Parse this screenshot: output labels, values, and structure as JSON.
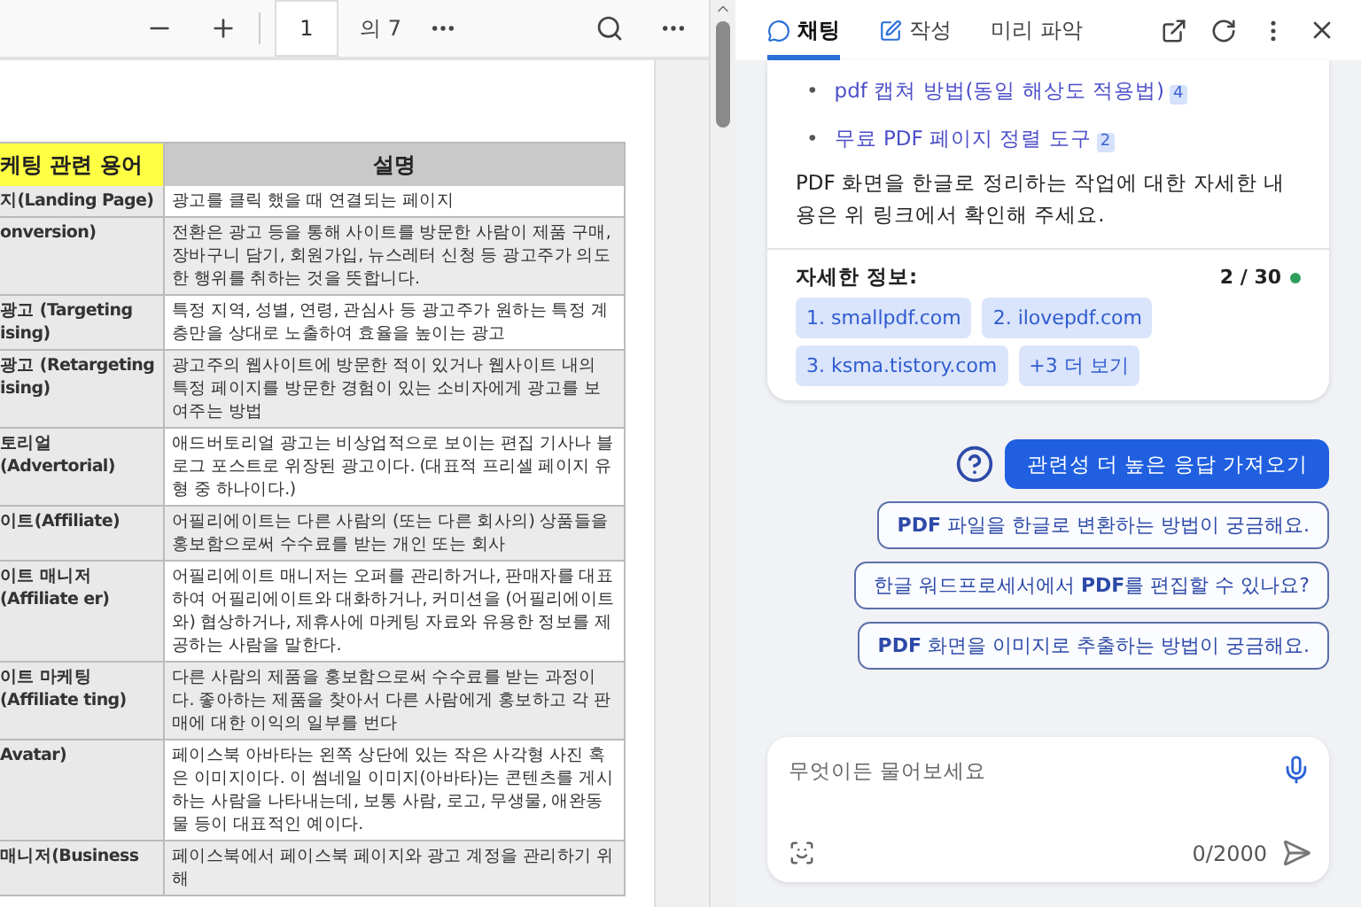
{
  "viewer_toolbar": {
    "page_number": "1",
    "page_total": "의 7"
  },
  "table": {
    "columns": [
      {
        "label": "케팅 관련 용어",
        "kind": "term"
      },
      {
        "label": "설명",
        "kind": "desc"
      }
    ],
    "rows": [
      {
        "term": "지(Landing Page)",
        "description": "광고를 클릭 했을 때 연결되는 페이지"
      },
      {
        "term": "onversion)",
        "description": "전환은 광고 등을 통해 사이트를 방문한 사람이 제품 구매, 장바구니 담기, 회원가입, 뉴스레터 신청 등 광고주가 의도한 행위를 취하는 것을 뜻합니다."
      },
      {
        "term": "광고 (Targeting ising)",
        "description": "특정 지역, 성별, 연령, 관심사 등 광고주가 원하는 특정 계층만을 상대로 노출하여 효율을 높이는 광고"
      },
      {
        "term": "광고 (Retargeting ising)",
        "description": "광고주의 웹사이트에 방문한 적이 있거나 웹사이트 내의 특정 페이지를 방문한 경험이 있는 소비자에게 광고를 보여주는 방법"
      },
      {
        "term": "토리얼(Advertorial)",
        "description": "애드버토리얼 광고는 비상업적으로 보이는 편집 기사나 블로그 포스트로 위장된 광고이다. (대표적 프리셀 페이지 유형 중 하나이다.)"
      },
      {
        "term": "이트(Affiliate)",
        "description": "어필리에이트는 다른 사람의 (또는 다른 회사의) 상품들을 홍보함으로써 수수료를 받는 개인 또는 회사"
      },
      {
        "term": "이트 매니저(Affiliate er)",
        "description": "어필리에이트 매니저는 오퍼를 관리하거나, 판매자를 대표하여 어필리에이트와 대화하거나, 커미션을 (어필리에이트와) 협상하거나, 제휴사에 마케팅 자료와 유용한 정보를 제공하는 사람을 말한다."
      },
      {
        "term": "이트 마케팅(Affiliate ting)",
        "description": "다른 사람의 제품을 홍보함으로써 수수료를 받는 과정이다. 좋아하는 제품을 찾아서 다른 사람에게 홍보하고 각 판매에 대한 이익의 일부를 번다"
      },
      {
        "term": "Avatar)",
        "description": "페이스북 아바타는 왼쪽 상단에 있는 작은 사각형 사진 혹은 이미지이다. 이 썸네일 이미지(아바타)는 콘텐츠를 게시하는 사람을 나타내는데, 보통 사람, 로고, 무생물, 애완동물 등이 대표적인 예이다."
      },
      {
        "term": "매니저(Business",
        "description": "페이스북에서 페이스북 페이지와 광고 계정을 관리하기 위해"
      }
    ]
  },
  "chat_header": {
    "tabs": [
      {
        "label": "채팅",
        "kind": "chat",
        "selected": true
      },
      {
        "label": "작성",
        "kind": "write",
        "selected": false
      },
      {
        "label": "미리 파악",
        "kind": "plain",
        "selected": false
      }
    ]
  },
  "answer_card": {
    "links": [
      {
        "bullet": "•",
        "text": "pdf 캡쳐 방법(동일 해상도 적용법)",
        "ref": "4"
      },
      {
        "bullet": "•",
        "text": "무료 PDF 페이지 정렬 도구",
        "ref": "2"
      }
    ],
    "summary": "PDF 화면을 한글로 정리하는 작업에 대한 자세한 내용은 위 링크에서 확인해 주세요.",
    "sources_label": "자세한 정보:",
    "counter": "2 / 30",
    "status_dot": {
      "color": "#2e9e5b"
    },
    "sources": [
      "1. smallpdf.com",
      "2. ilovepdf.com",
      "3. ksma.tistory.com",
      "+3 더 보기"
    ]
  },
  "refresh_button": "관련성 더 높은 응답 가져오기",
  "suggestions": [
    "**PDF** 파일을 한글로 변환하는 방법이 궁금해요.",
    "한글 워드프로세서에서 **PDF**를 편집할 수 있나요?",
    "**PDF** 화면을 이미지로 추출하는 방법이 궁금해요."
  ],
  "composer": {
    "placeholder": "무엇이든 물어보세요",
    "char_count": "0/2000"
  }
}
